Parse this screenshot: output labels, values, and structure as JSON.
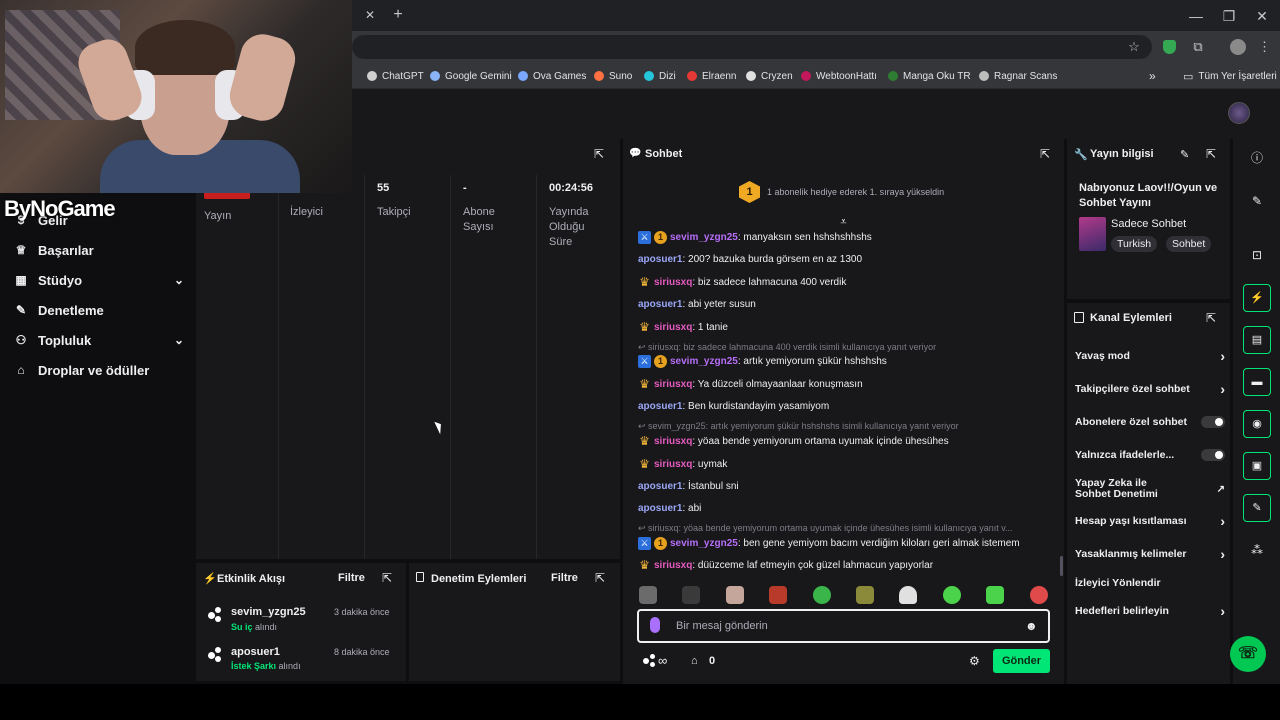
{
  "browser": {
    "new_tab": "+",
    "window_controls": {
      "minimize": "—",
      "restore": "❐",
      "close": "✕"
    },
    "bookmarks": [
      {
        "label": "ChatGPT",
        "color": "#d0d0d0"
      },
      {
        "label": "Google Gemini",
        "color": "#8ab4f8"
      },
      {
        "label": "Ova Games",
        "color": "#7aa7ff"
      },
      {
        "label": "Suno",
        "color": "#ff7043"
      },
      {
        "label": "Dizi",
        "color": "#26c6da"
      },
      {
        "label": "Elraenn",
        "color": "#e53935"
      },
      {
        "label": "Cryzen",
        "color": "#e0e0e0"
      },
      {
        "label": "WebtoonHattı",
        "color": "#c2185b"
      },
      {
        "label": "Manga Oku TR",
        "color": "#2e7d32"
      },
      {
        "label": "Ragnar Scans",
        "color": "#bdbdbd"
      }
    ],
    "bookmarks_overflow": "»",
    "all_bookmarks": "Tüm Yer İşaretleri"
  },
  "watermark": {
    "text": "ByNoGame"
  },
  "leftnav": {
    "items": [
      {
        "label": "Gelir",
        "icon": "dollar-icon",
        "glyph": "$",
        "chevron": false
      },
      {
        "label": "Başarılar",
        "icon": "trophy-icon",
        "glyph": "🏆",
        "chevron": false
      },
      {
        "label": "Stüdyo",
        "icon": "studio-icon",
        "glyph": "▦",
        "chevron": true
      },
      {
        "label": "Denetleme",
        "icon": "wrench-icon",
        "glyph": "🔧",
        "chevron": false
      },
      {
        "label": "Topluluk",
        "icon": "community-icon",
        "glyph": "👥",
        "chevron": true
      },
      {
        "label": "Droplar ve ödüller",
        "icon": "gift-icon",
        "glyph": "🎁",
        "chevron": false
      }
    ]
  },
  "stats": {
    "columns": [
      {
        "value": "",
        "label": "Yayın"
      },
      {
        "value": "",
        "label": "İzleyici"
      },
      {
        "value": "55",
        "label": "Takipçi"
      },
      {
        "value": "-",
        "label": "Abone Sayısı"
      },
      {
        "value": "00:24:56",
        "label": "Yayında Olduğu Süre"
      }
    ]
  },
  "activity": {
    "title": "Etkinlik Akışı",
    "filter": "Filtre",
    "items": [
      {
        "user": "sevim_yzgn25",
        "reward": "Su iç",
        "suffix": "alındı",
        "time": "3 dakika önce"
      },
      {
        "user": "aposuer1",
        "reward": "İstek Şarkı",
        "suffix": "alındı",
        "time": "8 dakika önce"
      }
    ]
  },
  "mod_actions": {
    "title": "Denetim Eylemleri",
    "filter": "Filtre"
  },
  "chat": {
    "title": "Sohbet",
    "banner_rank": "1",
    "banner_text": "1 abonelik hediye ederek 1. sıraya yükseldin",
    "messages": [
      {
        "type": "msg",
        "badges": [
          "mod",
          "sub"
        ],
        "user": "sevim_yzgn25",
        "ucolor": "purple",
        "text": ": manyaksın sen hshshshhshs"
      },
      {
        "type": "msg",
        "badges": [],
        "user": "aposuer1",
        "ucolor": "blue",
        "text": ": 200? bazuka burda görsem en az 1300"
      },
      {
        "type": "msg",
        "badges": [
          "crown"
        ],
        "user": "siriusxq",
        "ucolor": "pink",
        "text": ": biz sadece lahmacuna 400 verdik"
      },
      {
        "type": "msg",
        "badges": [],
        "user": "aposuer1",
        "ucolor": "blue",
        "text": ": abi yeter susun"
      },
      {
        "type": "msg",
        "badges": [
          "crown"
        ],
        "user": "siriusxq",
        "ucolor": "pink",
        "text": ": 1 tanie"
      },
      {
        "type": "reply",
        "text": "↩ siriusxq: biz sadece lahmacuna 400 verdik isimli kullanıcıya yanıt veriyor"
      },
      {
        "type": "msg",
        "badges": [
          "mod",
          "sub"
        ],
        "user": "sevim_yzgn25",
        "ucolor": "purple",
        "text": ": artık yemiyorum şükür hshshshs"
      },
      {
        "type": "msg",
        "badges": [
          "crown"
        ],
        "user": "siriusxq",
        "ucolor": "pink",
        "text": ": Ya düzceli olmayaanlaar konuşmasın"
      },
      {
        "type": "msg",
        "badges": [],
        "user": "aposuer1",
        "ucolor": "blue",
        "text": ": Ben kurdistandayim yasamiyom"
      },
      {
        "type": "reply",
        "text": "↩ sevim_yzgn25: artık yemiyorum şükür hshshshs isimli kullanıcıya yanıt veriyor"
      },
      {
        "type": "msg",
        "badges": [
          "crown"
        ],
        "user": "siriusxq",
        "ucolor": "pink",
        "text": ": yöaa bende yemiyorum ortama uyumak içinde ühesühes"
      },
      {
        "type": "msg",
        "badges": [
          "crown"
        ],
        "user": "siriusxq",
        "ucolor": "pink",
        "text": ": uymak"
      },
      {
        "type": "msg",
        "badges": [],
        "user": "aposuer1",
        "ucolor": "blue",
        "text": ": İstanbul sni"
      },
      {
        "type": "msg",
        "badges": [],
        "user": "aposuer1",
        "ucolor": "blue",
        "text": ": abi"
      },
      {
        "type": "reply",
        "text": "↩ siriusxq: yöaa bende yemiyorum ortama uyumak içinde ühesühes isimli kullanıcıya yanıt v..."
      },
      {
        "type": "msg",
        "badges": [
          "mod",
          "sub"
        ],
        "user": "sevim_yzgn25",
        "ucolor": "purple",
        "text": ": ben gene yemiyom bacım verdiğim kiloları geri almak istemem"
      },
      {
        "type": "msg",
        "badges": [
          "crown"
        ],
        "user": "siriusxq",
        "ucolor": "pink",
        "text": ": düüzceme laf etmeyin çok güzel lahmacun yapıyorlar"
      }
    ],
    "input_placeholder": "Bir mesaj gönderin",
    "points_infinity": "∞",
    "points_count": "0",
    "send_label": "Gönder"
  },
  "stream_info": {
    "title": "Yayın bilgisi",
    "stream_title": "Nabıyonuz Laov!!/Oyun ve Sohbet Yayını",
    "category": "Sadece Sohbet",
    "tags": [
      "Turkish",
      "Sohbet"
    ]
  },
  "channel_actions": {
    "title": "Kanal Eylemleri",
    "rows": [
      {
        "label": "Yavaş mod",
        "control": "chevron"
      },
      {
        "label": "Takipçilere özel sohbet",
        "control": "chevron"
      },
      {
        "label": "Abonelere özel sohbet",
        "control": "toggle"
      },
      {
        "label": "Yalnızca ifadelerle...",
        "control": "toggle"
      },
      {
        "label": "Yapay Zeka ile Sohbet Denetimi",
        "control": "external"
      },
      {
        "label": "Hesap yaşı kısıtlaması",
        "control": "chevron"
      },
      {
        "label": "Yasaklanmış kelimeler",
        "control": "chevron"
      },
      {
        "label": "İzleyici Yönlendir",
        "control": "none"
      },
      {
        "label": "Hedefleri belirleyin",
        "control": "chevron"
      }
    ]
  },
  "colors": {
    "accent": "#00e676",
    "panel": "#18181b",
    "bg": "#0e0e10"
  }
}
